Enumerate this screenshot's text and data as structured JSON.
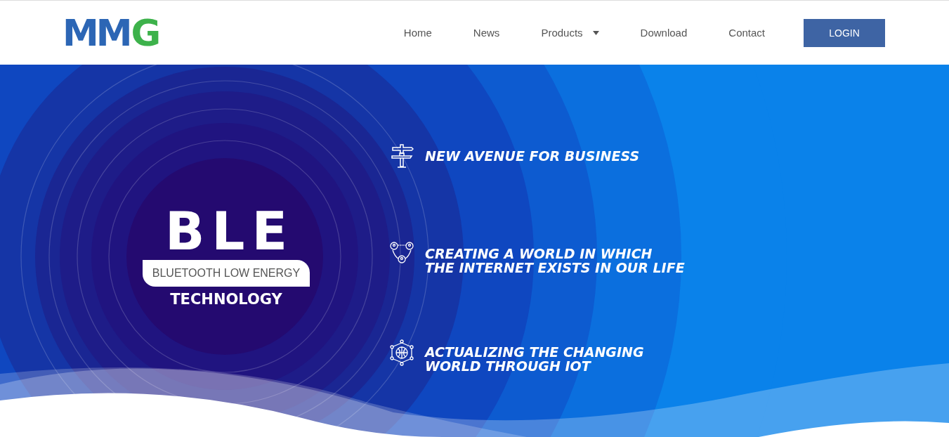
{
  "logo": {
    "letters": "MM",
    "accent": "G"
  },
  "nav": [
    {
      "label": "Home",
      "has_menu": false
    },
    {
      "label": "News",
      "has_menu": false
    },
    {
      "label": "Products",
      "has_menu": true
    },
    {
      "label": "Download",
      "has_menu": false
    },
    {
      "label": "Contact",
      "has_menu": false
    }
  ],
  "login_button": "LOGIN",
  "hero": {
    "title": "BLE",
    "subtitle": "BLUETOOTH LOW ENERGY",
    "tagline": "TECHNOLOGY",
    "features": [
      {
        "kind": "signpost",
        "lines": [
          "NEW AVENUE FOR BUSINESS"
        ]
      },
      {
        "kind": "people",
        "lines": [
          "CREATING A WORLD IN WHICH",
          "THE INTERNET EXISTS IN OUR LIFE"
        ]
      },
      {
        "kind": "network",
        "lines": [
          "ACTUALIZING THE CHANGING",
          "WORLD THROUGH IOT"
        ]
      }
    ]
  }
}
